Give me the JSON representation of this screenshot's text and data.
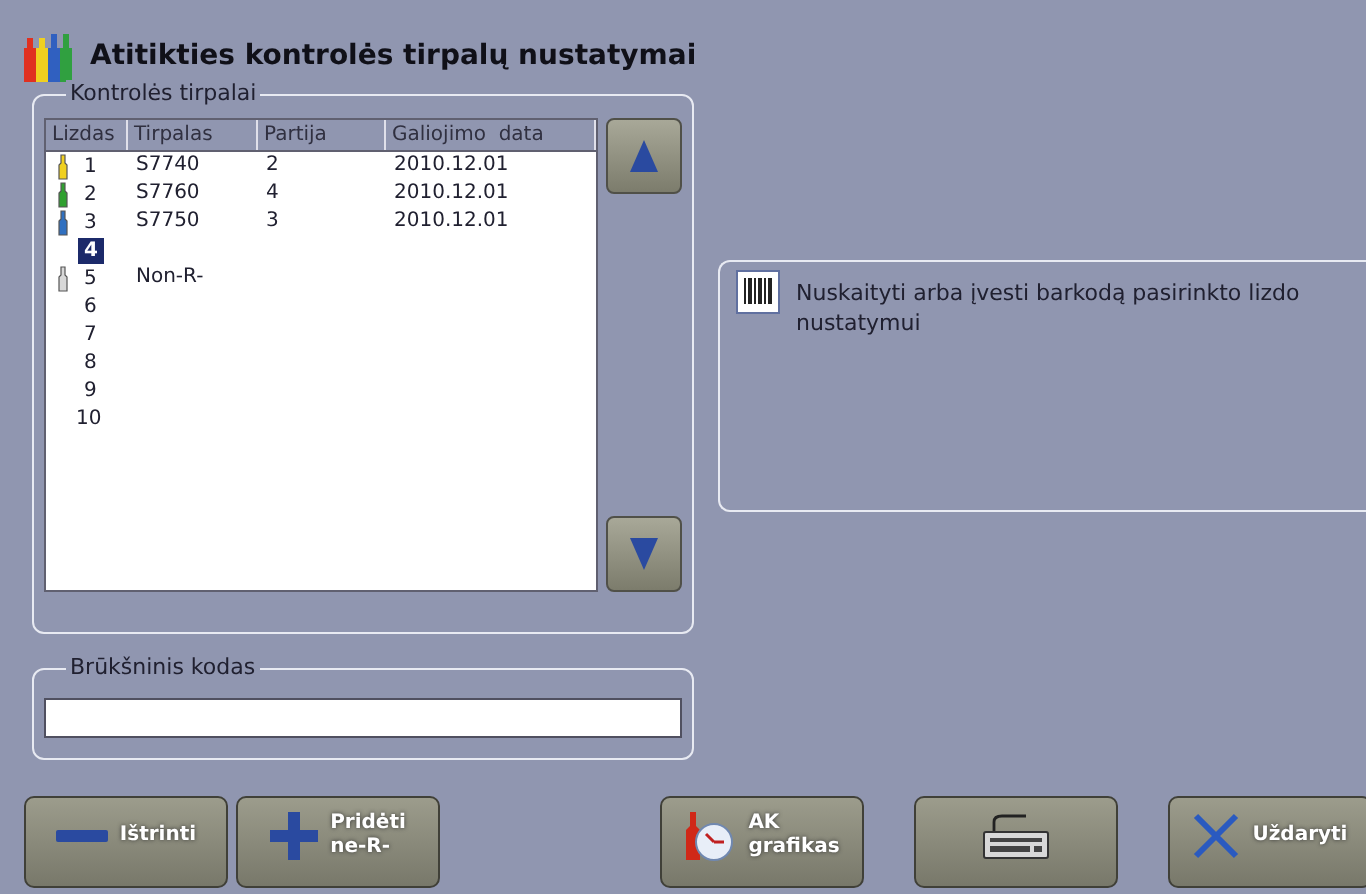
{
  "window": {
    "title": "Atitikties kontrolės tirpalų nustatymai"
  },
  "solutions_group": {
    "legend": "Kontrolės tirpalai",
    "columns": [
      "Lizdas",
      "Tirpalas",
      "Partija",
      "Galiojimo  data"
    ],
    "rows": [
      {
        "slot": "1",
        "solution": "S7740",
        "lot": "2",
        "date": "2010.12.01",
        "color": "#f0d020",
        "selected": false
      },
      {
        "slot": "2",
        "solution": "S7760",
        "lot": "4",
        "date": "2010.12.01",
        "color": "#30a030",
        "selected": false
      },
      {
        "slot": "3",
        "solution": "S7750",
        "lot": "3",
        "date": "2010.12.01",
        "color": "#3070c0",
        "selected": false
      },
      {
        "slot": "4",
        "selected": true
      },
      {
        "slot": "5",
        "solution": "Non-R-",
        "color": "#d8d8d8",
        "selected": false
      },
      {
        "slot": "6",
        "selected": false
      },
      {
        "slot": "7",
        "selected": false
      },
      {
        "slot": "8",
        "selected": false
      },
      {
        "slot": "9",
        "selected": false
      },
      {
        "slot": "10",
        "selected": false
      }
    ]
  },
  "info": {
    "text": "Nuskaityti arba įvesti barkodą pasirinkto lizdo nustatymui"
  },
  "barcode_group": {
    "legend": "Brūkšninis kodas"
  },
  "buttons": [
    {
      "kind": "minus",
      "label": "Ištrinti"
    },
    {
      "kind": "plus",
      "label": "Pridėti\nne-R-"
    },
    {
      "kind": "chart",
      "label": "AK\ngrafikas"
    },
    {
      "kind": "keyboard"
    },
    {
      "kind": "close",
      "label": "Uždaryti"
    }
  ]
}
